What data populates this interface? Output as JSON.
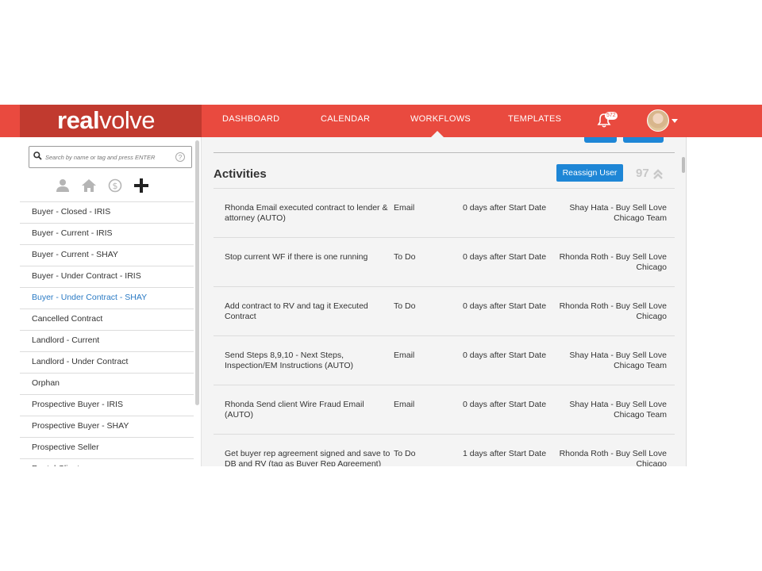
{
  "brand": {
    "logo_bold": "real",
    "logo_light": "volve"
  },
  "nav": {
    "items": [
      "DASHBOARD",
      "CALENDAR",
      "WORKFLOWS",
      "TEMPLATES"
    ],
    "active": "WORKFLOWS",
    "notification_count": "572"
  },
  "sidebar": {
    "search_placeholder": "Search by name or tag and press ENTER",
    "help_label": "?",
    "filter_icons": [
      "person-icon",
      "house-icon",
      "dollar-icon",
      "plus-icon"
    ],
    "items": [
      "Buyer - Closed - IRIS",
      "Buyer - Current - IRIS",
      "Buyer - Current - SHAY",
      "Buyer - Under Contract - IRIS",
      "Buyer - Under Contract - SHAY",
      "Cancelled Contract",
      "Landlord - Current",
      "Landlord - Under Contract",
      "Orphan",
      "Prospective Buyer - IRIS",
      "Prospective Buyer - SHAY",
      "Prospective Seller",
      "Rental Client"
    ],
    "active_index": 4
  },
  "main": {
    "section_title": "Activities",
    "reassign_label": "Reassign User",
    "count": "97",
    "activities": [
      {
        "name": "Rhonda Email executed contract to lender & attorney (AUTO)",
        "type": "Email",
        "due": "0 days after Start Date",
        "team": "Shay Hata - Buy Sell Love Chicago Team"
      },
      {
        "name": "Stop current WF if there is one running",
        "type": "To Do",
        "due": "0 days after Start Date",
        "team": "Rhonda Roth - Buy Sell Love Chicago"
      },
      {
        "name": "Add contract to RV and tag it Executed Contract",
        "type": "To Do",
        "due": "0 days after Start Date",
        "team": "Rhonda Roth - Buy Sell Love Chicago"
      },
      {
        "name": "Send Steps 8,9,10 - Next Steps, Inspection/EM Instructions (AUTO)",
        "type": "Email",
        "due": "0 days after Start Date",
        "team": "Shay Hata - Buy Sell Love Chicago Team"
      },
      {
        "name": "Rhonda Send client Wire Fraud Email (AUTO)",
        "type": "Email",
        "due": "0 days after Start Date",
        "team": "Shay Hata - Buy Sell Love Chicago Team"
      },
      {
        "name": "Get buyer rep agreement signed and save to DB and RV (tag as Buyer Rep Agreement)",
        "type": "To Do",
        "due": "1 days after Start Date",
        "team": "Rhonda Roth - Buy Sell Love Chicago"
      }
    ]
  },
  "colors": {
    "brand_red": "#e94a3f",
    "brand_dark": "#c13a2f",
    "accent_blue": "#1e86d6",
    "link_blue": "#2a7ac4"
  }
}
